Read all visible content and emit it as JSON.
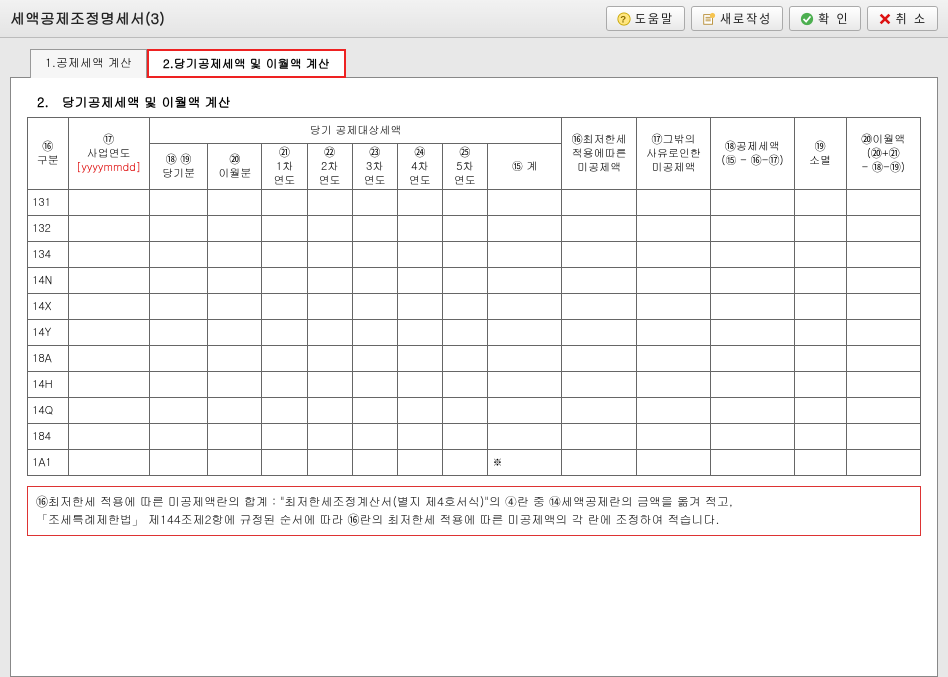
{
  "header": {
    "title": "세액공제조정명세서(3)"
  },
  "toolbar": {
    "help": "도움말",
    "new": "새로작성",
    "confirm": "확 인",
    "cancel": "취 소"
  },
  "tabs": {
    "tab1": "1.공제세액 계산",
    "tab2": "2.당기공제세액 및 이월액 계산"
  },
  "section": {
    "title": "2.　당기공제세액 및 이월액 계산"
  },
  "headers": {
    "gubun": "⑯\n구분",
    "year": "⑰\n사업연도",
    "year_fmt": "[yyyymmdd]",
    "midgroup": "당기 공제대상세액",
    "c1": "⑱ ⑲\n당기분",
    "c2": "⑳\n이월분",
    "c3": "㉑\n1차\n연도",
    "c4": "㉒\n2차\n연도",
    "c5": "㉓\n3차\n연도",
    "c6": "㉔\n4차\n연도",
    "c7": "㉕\n5차\n연도",
    "c8": "⑮ 계",
    "c9": "⑯최저한세\n적용에따른\n미공제액",
    "c10": "⑰그밖의\n사유로인한\n미공제액",
    "c11": "⑱공제세액\n(⑮ - ⑯-⑰)",
    "c12": "⑲\n소멸",
    "c13": "⑳이월액\n(⑳+㉑\n- ⑱-⑲)"
  },
  "rows": [
    {
      "code": "131"
    },
    {
      "code": "132"
    },
    {
      "code": "134"
    },
    {
      "code": "14N"
    },
    {
      "code": "14X"
    },
    {
      "code": "14Y"
    },
    {
      "code": "18A"
    },
    {
      "code": "14H"
    },
    {
      "code": "14Q"
    },
    {
      "code": "184"
    },
    {
      "code": "1A1",
      "mark": "※"
    }
  ],
  "footnote": {
    "line1": "⑯최저한세 적용에 따른 미공제액란의 합계 : \"최저한세조정계산서(별지 제4호서식)\"의 ④란 중 ⑭세액공제란의 금액을 옮겨 적고,",
    "line2": "「조세특례제한법」 제144조제2항에 규정된 순서에 따라 ⑯란의 최저한세 적용에 따른 미공제액의 각 란에 조정하여 적습니다."
  }
}
